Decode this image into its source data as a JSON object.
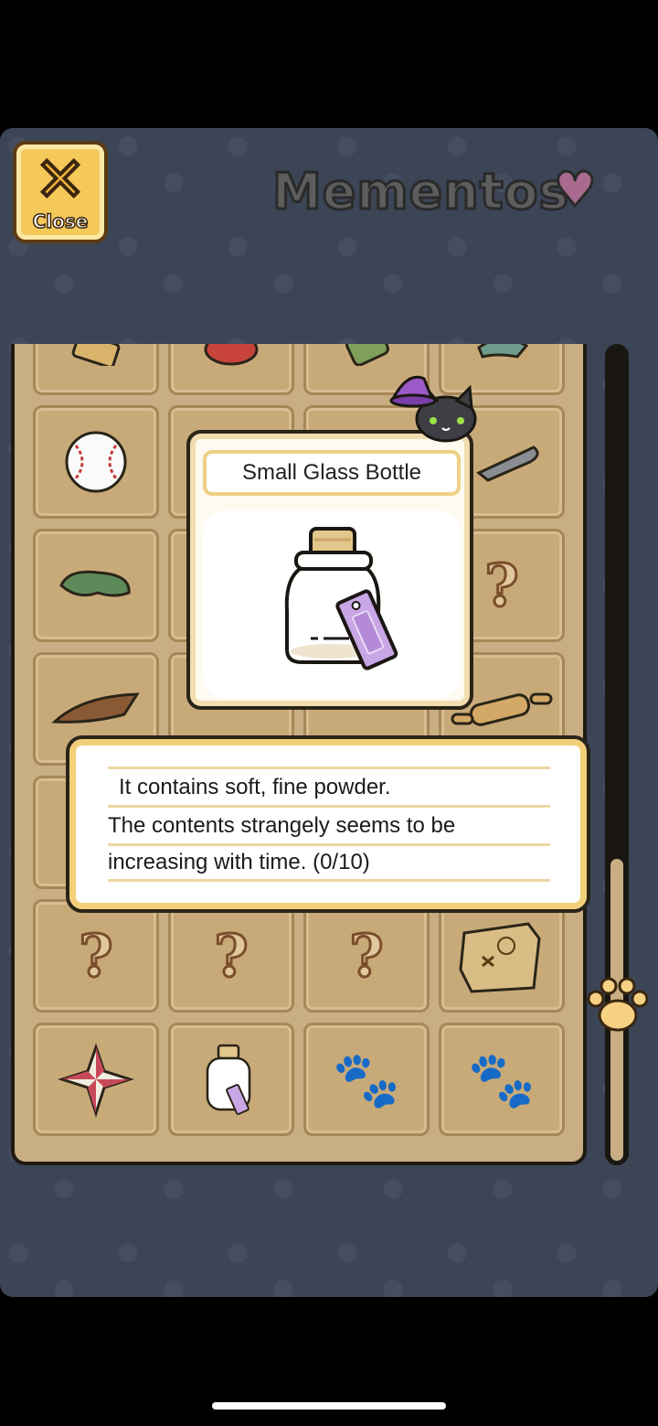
{
  "header": {
    "close_icon_glyph": "✕",
    "close_label": "Close",
    "title": "Mementos"
  },
  "grid": {
    "rows": [
      [
        "carving-icon",
        "daruma-icon",
        "bottle-icon",
        "jade-icon"
      ],
      [
        "baseball-icon",
        "",
        "",
        "knife-icon"
      ],
      [
        "green-stone-icon",
        "",
        "",
        "unknown-icon"
      ],
      [
        "wood-chip-icon",
        "",
        "",
        "rolling-pin-icon"
      ],
      [
        "",
        "",
        "",
        ""
      ],
      [
        "unknown-icon",
        "unknown-icon",
        "unknown-icon",
        "treasure-map-icon"
      ],
      [
        "shuriken-icon",
        "small-glass-bottle-icon",
        "paw-icon",
        "paw-icon"
      ]
    ]
  },
  "detail": {
    "item_name": "Small Glass Bottle",
    "description_lines": [
      "It contains soft, fine powder.",
      "The contents strangely seems to be",
      "increasing with time. (0/10)"
    ]
  },
  "colors": {
    "background": "#3b4556",
    "board": "#c9ae83",
    "card_border": "#f2cf78",
    "tag": "#c9a6e6"
  },
  "scroll": {
    "position_fraction": 0.62
  }
}
